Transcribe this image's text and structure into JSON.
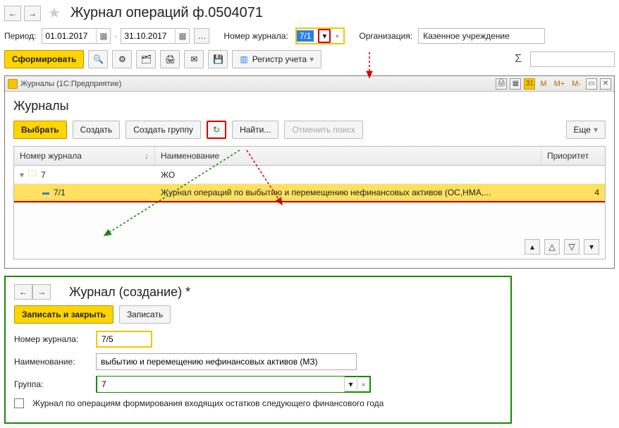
{
  "header": {
    "title": "Журнал операций ф.0504071"
  },
  "period": {
    "label": "Период:",
    "from": "01.01.2017",
    "to": "31.10.2017",
    "journal_number_label": "Номер журнала:",
    "journal_number": "7/1",
    "org_label": "Организация:",
    "org_value": "Казенное учреждение"
  },
  "toolbar": {
    "form_label": "Сформировать",
    "registry_label": "Регистр учета"
  },
  "dialog": {
    "titlebar": "Журналы (1С:Предприятие)",
    "m": "M",
    "mp": "M+",
    "mm": "M-",
    "title": "Журналы",
    "buttons": {
      "select": "Выбрать",
      "create": "Создать",
      "create_group": "Создать группу",
      "find": "Найти...",
      "cancel_search": "Отменить поиск",
      "more": "Еще"
    },
    "columns": {
      "number": "Номер журнала",
      "name": "Наименование",
      "priority": "Приоритет"
    },
    "rows": [
      {
        "num": "7",
        "name": "ЖО",
        "prio": "",
        "group": true
      },
      {
        "num": "7/1",
        "name": "Журнал операций по выбытию и перемещению нефинансовых активов (ОС,НМА,...",
        "prio": "4",
        "group": false
      }
    ]
  },
  "form": {
    "title": "Журнал (создание) *",
    "save_close": "Записать и закрыть",
    "save": "Записать",
    "number_label": "Номер журнала:",
    "number": "7/5",
    "name_label": "Наименование:",
    "name": "выбытию и перемещению нефинансовых активов (МЗ)",
    "group_label": "Группа:",
    "group": "7",
    "checkbox_label": "Журнал по операциям формирования входящих остатков следующего финансового года"
  }
}
